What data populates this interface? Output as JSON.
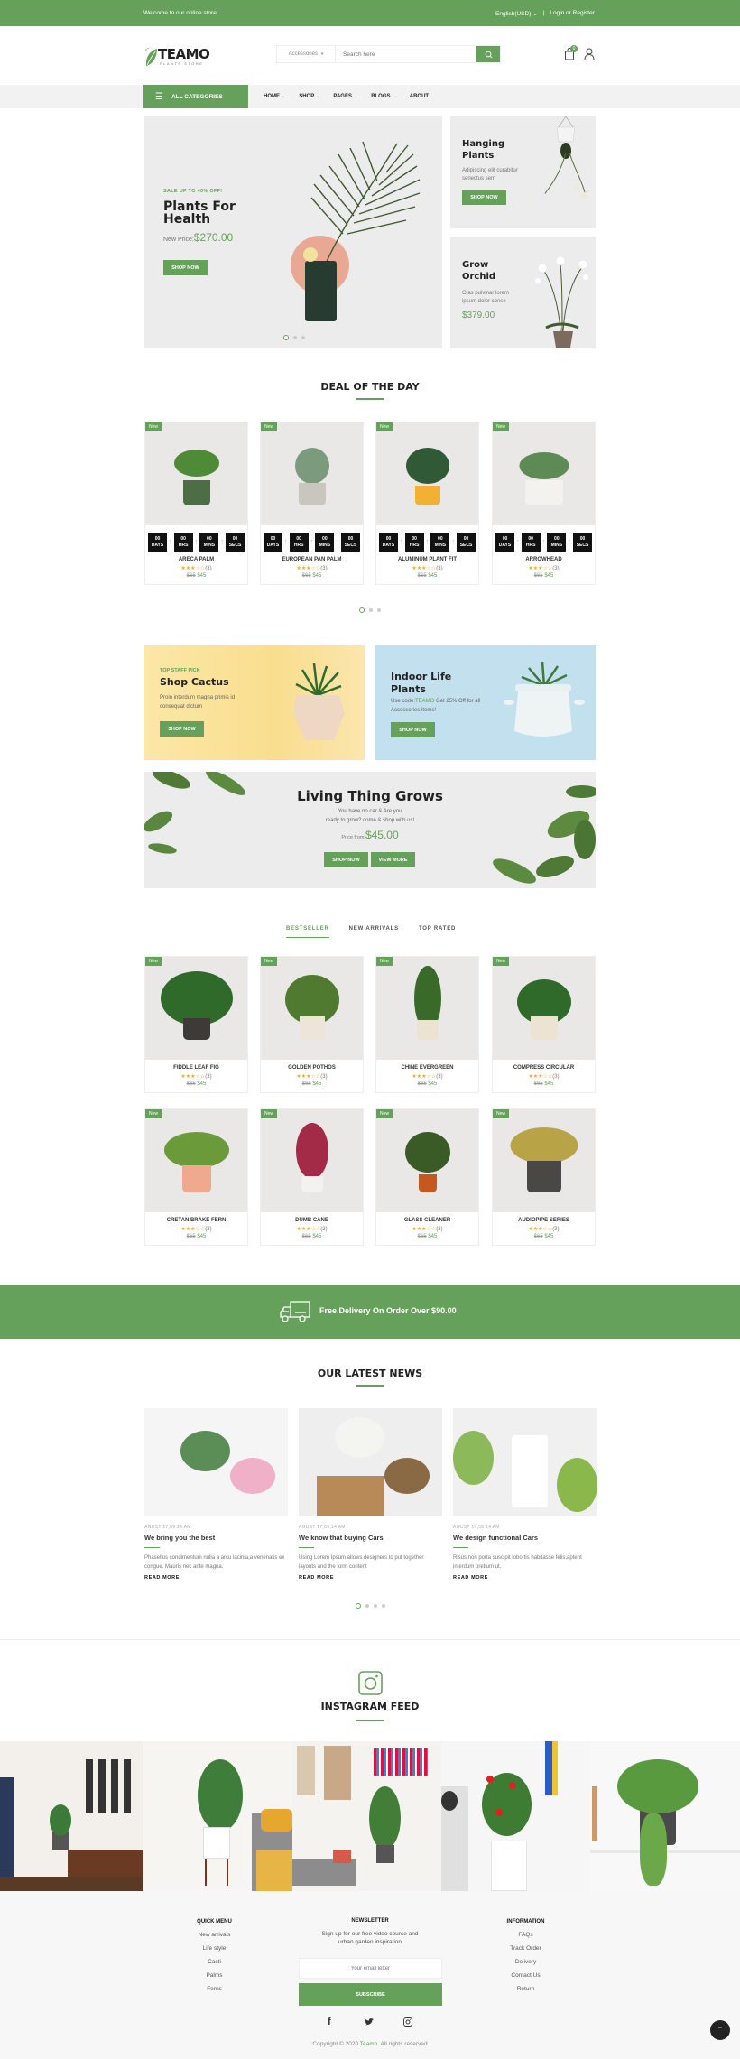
{
  "topbar": {
    "welcome": "Welcome to our online store!",
    "language": "English(USD)",
    "login": "Login or Register"
  },
  "header": {
    "logo_name": "TEAMO",
    "logo_sub": "PLANTS STORE",
    "search_category": "Accessories",
    "search_placeholder": "Search here",
    "cart_count": "0"
  },
  "nav": {
    "all_categories": "ALL CATEGORIES",
    "items": [
      "HOME",
      "SHOP",
      "PAGES",
      "BLOGS",
      "ABOUT"
    ]
  },
  "hero": {
    "sale": "SALE UP TO 40% OFF!",
    "title": "Plants For Health",
    "price_label": "New Price:",
    "price": "$270.00",
    "button": "SHOP NOW"
  },
  "side_banners": [
    {
      "title": "Hanging Plants",
      "text": "Adipiscing elit curabitur senectus sem",
      "button": "SHOP NOW"
    },
    {
      "title": "Grow Orchid",
      "text": "Cras pulvinar lorem ipsum dolor conse",
      "price": "$379.00"
    }
  ],
  "deal": {
    "title": "DEAL OF THE DAY",
    "timer_labels": [
      "DAYS",
      "HRS",
      "MINS",
      "SECS"
    ],
    "timer_values": [
      "00",
      "00",
      "00",
      "00"
    ],
    "products": [
      {
        "badge": "New",
        "name": "ARECA PALM",
        "rating": 3,
        "reviews": "(3)",
        "old_price": "$65",
        "price": "$45"
      },
      {
        "badge": "New",
        "name": "EUROPEAN PAN PALM",
        "rating": 3,
        "reviews": "(3)",
        "old_price": "$65",
        "price": "$45"
      },
      {
        "badge": "New",
        "name": "ALUMINUM PLANT FIT",
        "rating": 3,
        "reviews": "(3)",
        "old_price": "$65",
        "price": "$45"
      },
      {
        "badge": "New",
        "name": "ARROWHEAD",
        "rating": 3,
        "reviews": "(3)",
        "old_price": "$65",
        "price": "$45"
      }
    ]
  },
  "promo": {
    "cactus": {
      "kicker": "TOP STAFF PICK",
      "title": "Shop Cactus",
      "text": "Proin interdum magna primis id consequat dictum",
      "button": "SHOP NOW"
    },
    "indoor": {
      "title": "Indoor Life Plants",
      "text_pre": "Use code:",
      "code": "TEAMO",
      "text_post": " Get 25% Off for all Accessories items!",
      "button": "SHOP NOW"
    },
    "living": {
      "title": "Living Thing Grows",
      "line1": "You have no car & Are you",
      "line2": "ready to grow? come & shop with us!",
      "price_label": "Price from:",
      "price": "$45.00",
      "button1": "SHOP NOW",
      "button2": "VIEW MORE"
    }
  },
  "tabs": [
    "BESTSELLER",
    "NEW ARRIVALS",
    "TOP RATED"
  ],
  "products": [
    {
      "badge": "New",
      "name": "FIDDLE LEAF FIG",
      "rating": 3,
      "reviews": "(3)",
      "old_price": "$65",
      "price": "$45"
    },
    {
      "badge": "New",
      "name": "GOLDEN POTHOS",
      "rating": 3,
      "reviews": "(3)",
      "old_price": "$65",
      "price": "$45"
    },
    {
      "badge": "New",
      "name": "CHINE EVERGREEN",
      "rating": 3,
      "reviews": "(3)",
      "old_price": "$65",
      "price": "$45"
    },
    {
      "badge": "New",
      "name": "COMPRESS CIRCULAR",
      "rating": 3,
      "reviews": "(3)",
      "old_price": "$65",
      "price": "$45"
    },
    {
      "badge": "New",
      "name": "CRETAN BRAKE FERN",
      "rating": 3,
      "reviews": "(3)",
      "old_price": "$65",
      "price": "$45"
    },
    {
      "badge": "New",
      "name": "DUMB CANE",
      "rating": 3,
      "reviews": "(3)",
      "old_price": "$65",
      "price": "$45"
    },
    {
      "badge": "New",
      "name": "GLASS CLEANER",
      "rating": 3,
      "reviews": "(3)",
      "old_price": "$65",
      "price": "$45"
    },
    {
      "badge": "New",
      "name": "AUDIOPIPE SERIES",
      "rating": 3,
      "reviews": "(3)",
      "old_price": "$65",
      "price": "$45"
    }
  ],
  "delivery": {
    "text": "Free Delivery On Order Over $90.00"
  },
  "news": {
    "title": "OUR LATEST NEWS",
    "posts": [
      {
        "date": "AGUST 17,09:14 AM",
        "title": "We bring you the best",
        "text": "Phasellus condimentum nulla a arcu lacinia,a venenatis ex congue. Mauris nec ante magna.",
        "more": "READ MORE"
      },
      {
        "date": "AGUST 17,09:14 AM",
        "title": "We know that buying Cars",
        "text": "Using Lorem Ipsum allows designers to put together layouts and the form content",
        "more": "READ MORE"
      },
      {
        "date": "AGUST 17,09:14 AM",
        "title": "We design functional Cars",
        "text": "Risus non porta suscipit lobortis habitasse felis,aptent interdum pretium ut.",
        "more": "READ MORE"
      }
    ]
  },
  "instagram": {
    "title": "INSTAGRAM FEED"
  },
  "footer": {
    "quick_menu": {
      "title": "QUICK MENU",
      "links": [
        "New arrivals",
        "Life style",
        "Cacti",
        "Palms",
        "Ferns"
      ]
    },
    "newsletter": {
      "title": "NEWSLETTER",
      "line1": "Sign up for our free video course and",
      "line2": "urban garden inspiration",
      "placeholder": "Your email letter",
      "button": "SUBSCRIBE"
    },
    "information": {
      "title": "INFORMATION",
      "links": [
        "FAQs",
        "Track Order",
        "Delivery",
        "Contact Us",
        "Return"
      ]
    },
    "copyright_pre": "Copyright © 2020 ",
    "copyright_brand": "Teamo",
    "copyright_post": ". All rights reserved"
  },
  "colors": {
    "accent": "#65a15a",
    "dark": "#222222",
    "panel": "#ececec"
  }
}
